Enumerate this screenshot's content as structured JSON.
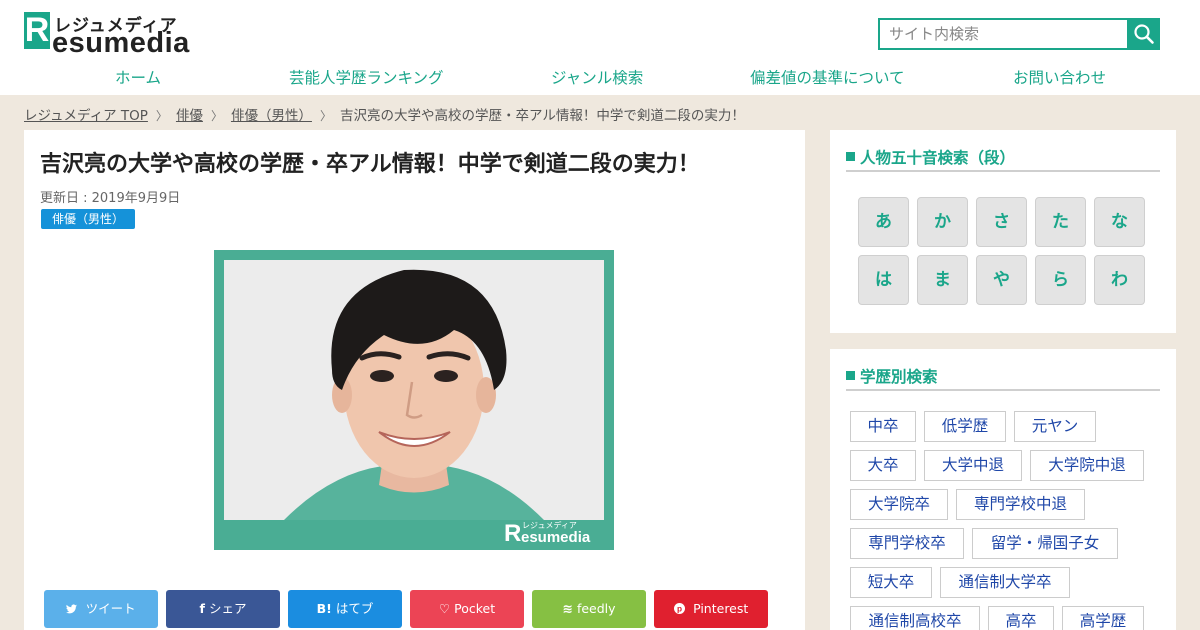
{
  "header": {
    "logo_r": "R",
    "logo_kana": "レジュメディア",
    "logo_rest": "esumedia",
    "search_placeholder": "サイト内検索"
  },
  "nav": [
    "ホーム",
    "芸能人学歴ランキング",
    "ジャンル検索",
    "偏差値の基準について",
    "お問い合わせ"
  ],
  "breadcrumb": {
    "items": [
      "レジュメディア TOP",
      "俳優",
      "俳優（男性）"
    ],
    "current": "吉沢亮の大学や高校の学歴・卒アル情報！中学で剣道二段の実力！"
  },
  "article": {
    "title": "吉沢亮の大学や高校の学歴・卒アル情報！中学で剣道二段の実力！",
    "updated": "更新日 : 2019年9月9日",
    "category": "俳優（男性）",
    "watermark_r": "R",
    "watermark_kana": "レジュメディア",
    "watermark_rest": "esumedia"
  },
  "share": [
    {
      "icon": "twitter-icon",
      "glyph": "🐦",
      "label": "ツイート",
      "color": "#5bb0ea"
    },
    {
      "icon": "facebook-icon",
      "glyph": "f",
      "label": "シェア",
      "color": "#3a5796"
    },
    {
      "icon": "hatena-icon",
      "glyph": "B!",
      "label": "はてブ",
      "color": "#1b8de0"
    },
    {
      "icon": "pocket-icon",
      "glyph": "♡",
      "label": "Pocket",
      "color": "#ec4455"
    },
    {
      "icon": "feedly-icon",
      "glyph": "≋",
      "label": "feedly",
      "color": "#86c043"
    },
    {
      "icon": "pinterest-icon",
      "glyph": "P",
      "label": "Pinterest",
      "color": "#e0202f"
    }
  ],
  "sidebar": {
    "kana_title": "人物五十音検索（段）",
    "kana": [
      "あ",
      "か",
      "さ",
      "た",
      "な",
      "は",
      "ま",
      "や",
      "ら",
      "わ"
    ],
    "edu_title": "学歴別検索",
    "tags": [
      "中卒",
      "低学歴",
      "元ヤン",
      "大卒",
      "大学中退",
      "大学院中退",
      "大学院卒",
      "専門学校中退",
      "専門学校卒",
      "留学・帰国子女",
      "短大卒",
      "通信制大学卒",
      "通信制高校卒",
      "高卒",
      "高学歴"
    ]
  },
  "colors": {
    "accent": "#1aa68a",
    "tag_text": "#1f47a8",
    "category_badge": "#1592d9",
    "page_bg": "#efe8de"
  }
}
